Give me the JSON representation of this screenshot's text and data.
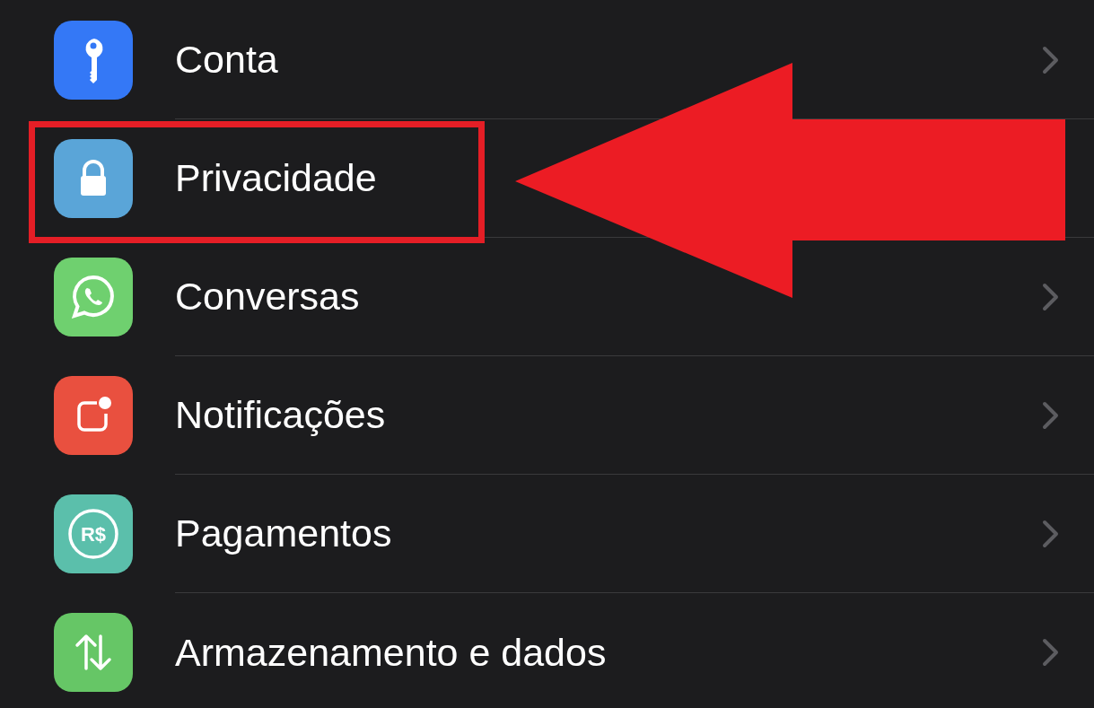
{
  "settings_items": [
    {
      "label": "Conta",
      "kind": "key",
      "color": "#3478f6",
      "chevron": true,
      "highlighted": false
    },
    {
      "label": "Privacidade",
      "kind": "lock",
      "color": "#5aa5d8",
      "chevron": false,
      "highlighted": true
    },
    {
      "label": "Conversas",
      "kind": "chat",
      "color": "#6fd06f",
      "chevron": true,
      "highlighted": false
    },
    {
      "label": "Notificações",
      "kind": "notification",
      "color": "#e9503f",
      "chevron": true,
      "highlighted": false
    },
    {
      "label": "Pagamentos",
      "kind": "currency",
      "icon_text": "R$",
      "color": "#5bbfab",
      "chevron": true,
      "highlighted": false
    },
    {
      "label": "Armazenamento e dados",
      "kind": "arrows",
      "color": "#66c666",
      "chevron": true,
      "highlighted": false
    }
  ],
  "annotation": {
    "kind": "arrow"
  }
}
